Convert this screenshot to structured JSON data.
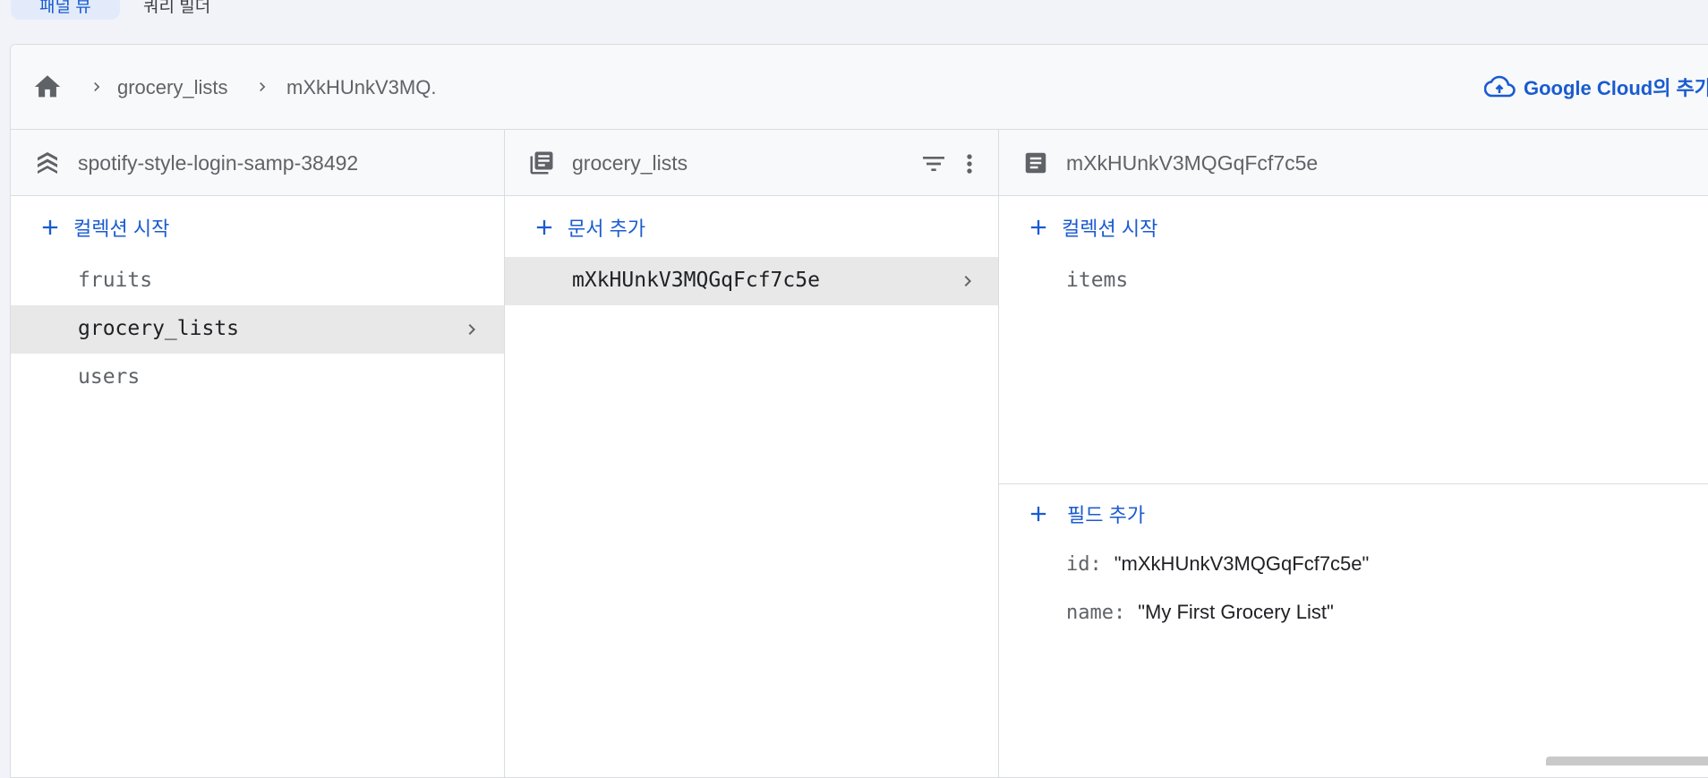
{
  "top_tabs": {
    "active_label": "패널 뷰",
    "second_label": "쿼리 빌더"
  },
  "breadcrumb": {
    "home_icon": "home-icon",
    "items": [
      "grocery_lists",
      "mXkHUnkV3MQ."
    ]
  },
  "gcloud": {
    "icon": "cloud-icon",
    "label": "Google Cloud의 추가 기능"
  },
  "root_column": {
    "icon": "firestore-icon",
    "title": "spotify-style-login-samp-38492",
    "add_label": "컬렉션 시작",
    "items": [
      "fruits",
      "grocery_lists",
      "users"
    ],
    "selected": "grocery_lists"
  },
  "collection_column": {
    "icon": "collection-icon",
    "title": "grocery_lists",
    "add_label": "문서 추가",
    "items": [
      "mXkHUnkV3MQGqFcf7c5e"
    ],
    "selected": "mXkHUnkV3MQGqFcf7c5e"
  },
  "document_column": {
    "icon": "document-icon",
    "title": "mXkHUnkV3MQGqFcf7c5e",
    "add_collection_label": "컬렉션 시작",
    "subcollections": [
      "items"
    ],
    "add_field_label": "필드 추가",
    "fields": [
      {
        "key": "id",
        "value": "\"mXkHUnkV3MQGqFcf7c5e\""
      },
      {
        "key": "name",
        "value": "\"My First Grocery List\""
      }
    ]
  },
  "colors": {
    "accent": "#1a5bd0",
    "selected_bg": "#e8e8e8",
    "header_bg": "#f8f9fa"
  }
}
